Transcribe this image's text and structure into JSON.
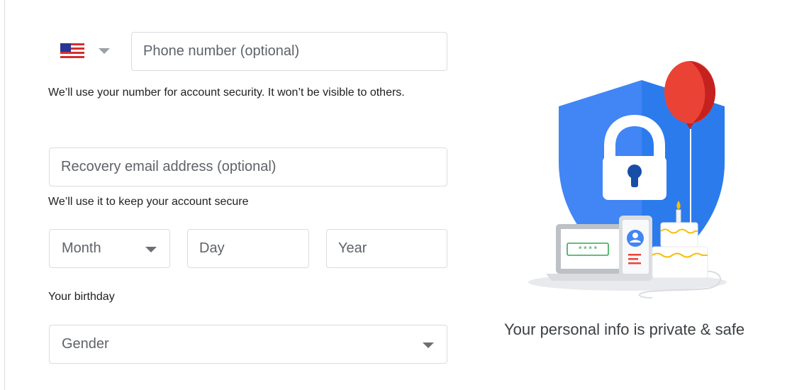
{
  "phone": {
    "country_flag": "us-flag-icon",
    "placeholder": "Phone number (optional)",
    "value": "",
    "hint": "We’ll use your number for account security. It won’t be visible to others."
  },
  "recovery_email": {
    "placeholder": "Recovery email address (optional)",
    "value": "",
    "hint": "We’ll use it to keep your account secure"
  },
  "birthday": {
    "month_label": "Month",
    "day_placeholder": "Day",
    "year_placeholder": "Year",
    "hint": "Your birthday"
  },
  "gender": {
    "label": "Gender"
  },
  "illustration": {
    "tagline": "Your personal info is private & safe",
    "password_mask": "****",
    "shield_color": "#4285f4",
    "balloon_color": "#ea4335"
  }
}
